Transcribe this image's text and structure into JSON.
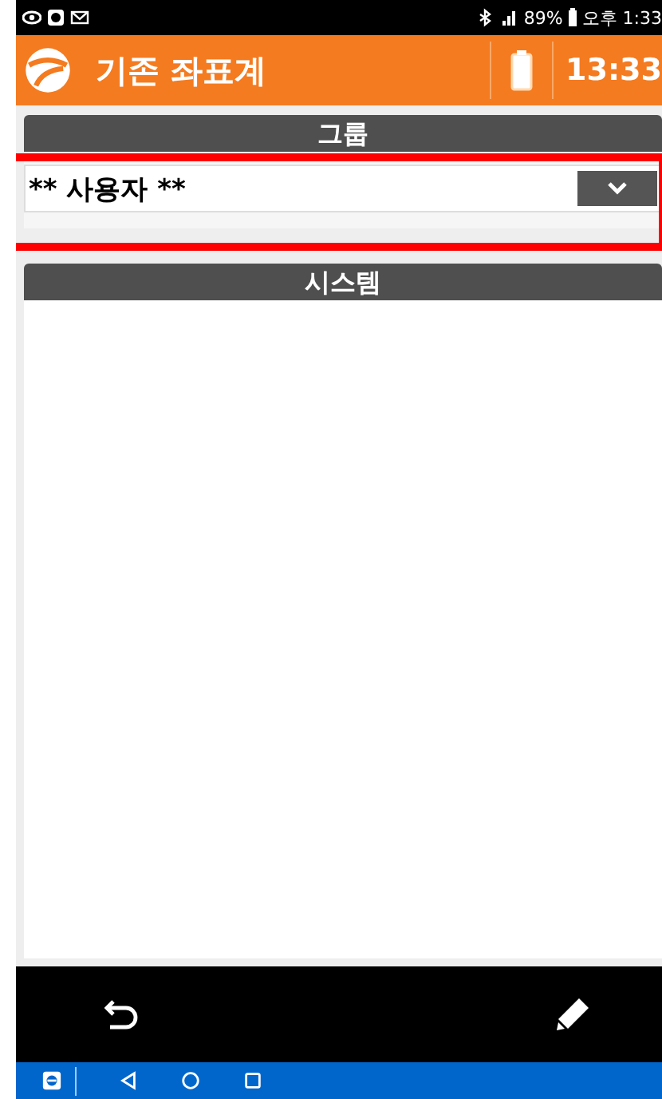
{
  "status_bar": {
    "battery": "89%",
    "time": "오후 1:33"
  },
  "header": {
    "title": "기존 좌표계",
    "clock": "13:33"
  },
  "group": {
    "heading": "그룹",
    "value": "** 사용자 **",
    "highlighted": true
  },
  "system": {
    "heading": "시스템"
  }
}
